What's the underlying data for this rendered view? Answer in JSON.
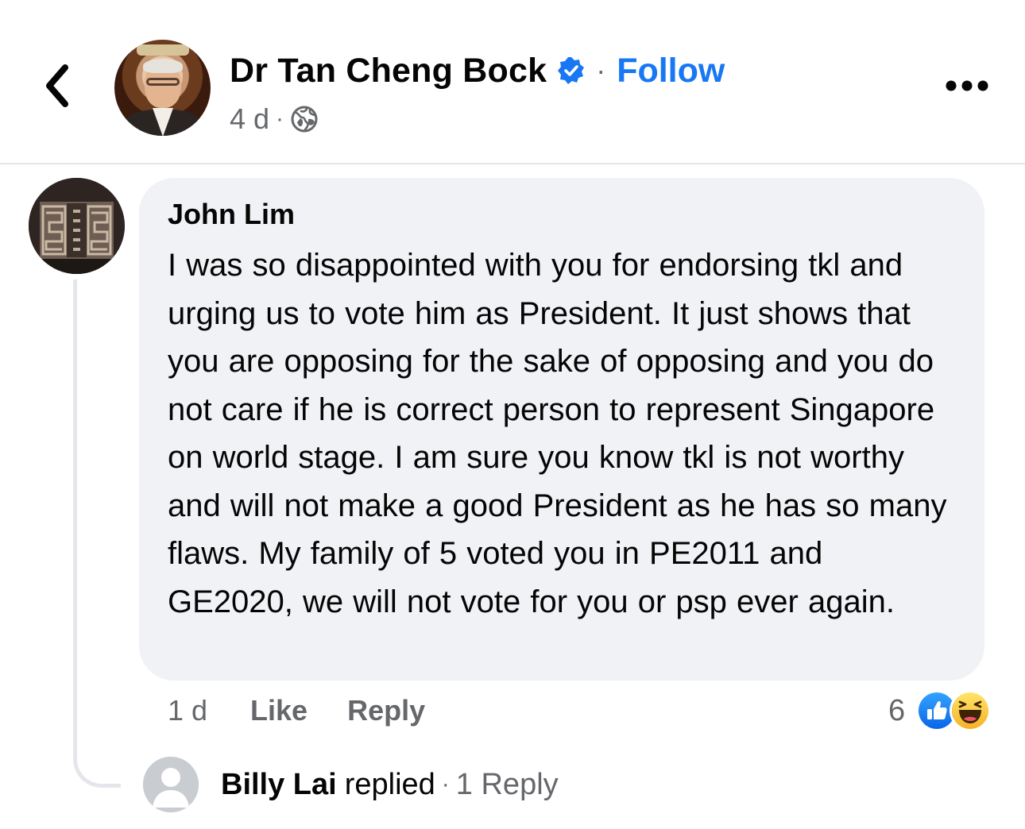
{
  "header": {
    "back_icon": "chevron-left-icon",
    "author_name": "Dr Tan Cheng Bock",
    "verified_icon": "verified-badge-icon",
    "separator": "·",
    "follow_label": "Follow",
    "time_ago": "4 d",
    "meta_separator": "·",
    "audience_icon": "globe-icon",
    "more_icon": "more-horizontal-icon"
  },
  "comment": {
    "author": "John Lim",
    "text": "I was so disappointed with you for endorsing tkl and urging us to vote him as President. It just shows that you are opposing for the sake of opposing and you do not care if he is correct person to represent Singapore on world stage. I am sure you know tkl is not worthy and will not make a good President as he has so many flaws. My family of 5 voted you in PE2011 and GE2020, we will not vote for you or psp ever again.",
    "time_ago": "1 d",
    "like_label": "Like",
    "reply_label": "Reply",
    "reaction_count": "6",
    "reaction_icons": [
      "like-reaction-icon",
      "haha-reaction-icon"
    ]
  },
  "reply_summary": {
    "name": "Billy Lai",
    "verb": "replied",
    "separator": "·",
    "count_label": "1 Reply"
  },
  "colors": {
    "accent": "#1877f2",
    "bubble": "#f0f2f5",
    "secondary_text": "#65676b",
    "divider": "#e4e6eb"
  }
}
